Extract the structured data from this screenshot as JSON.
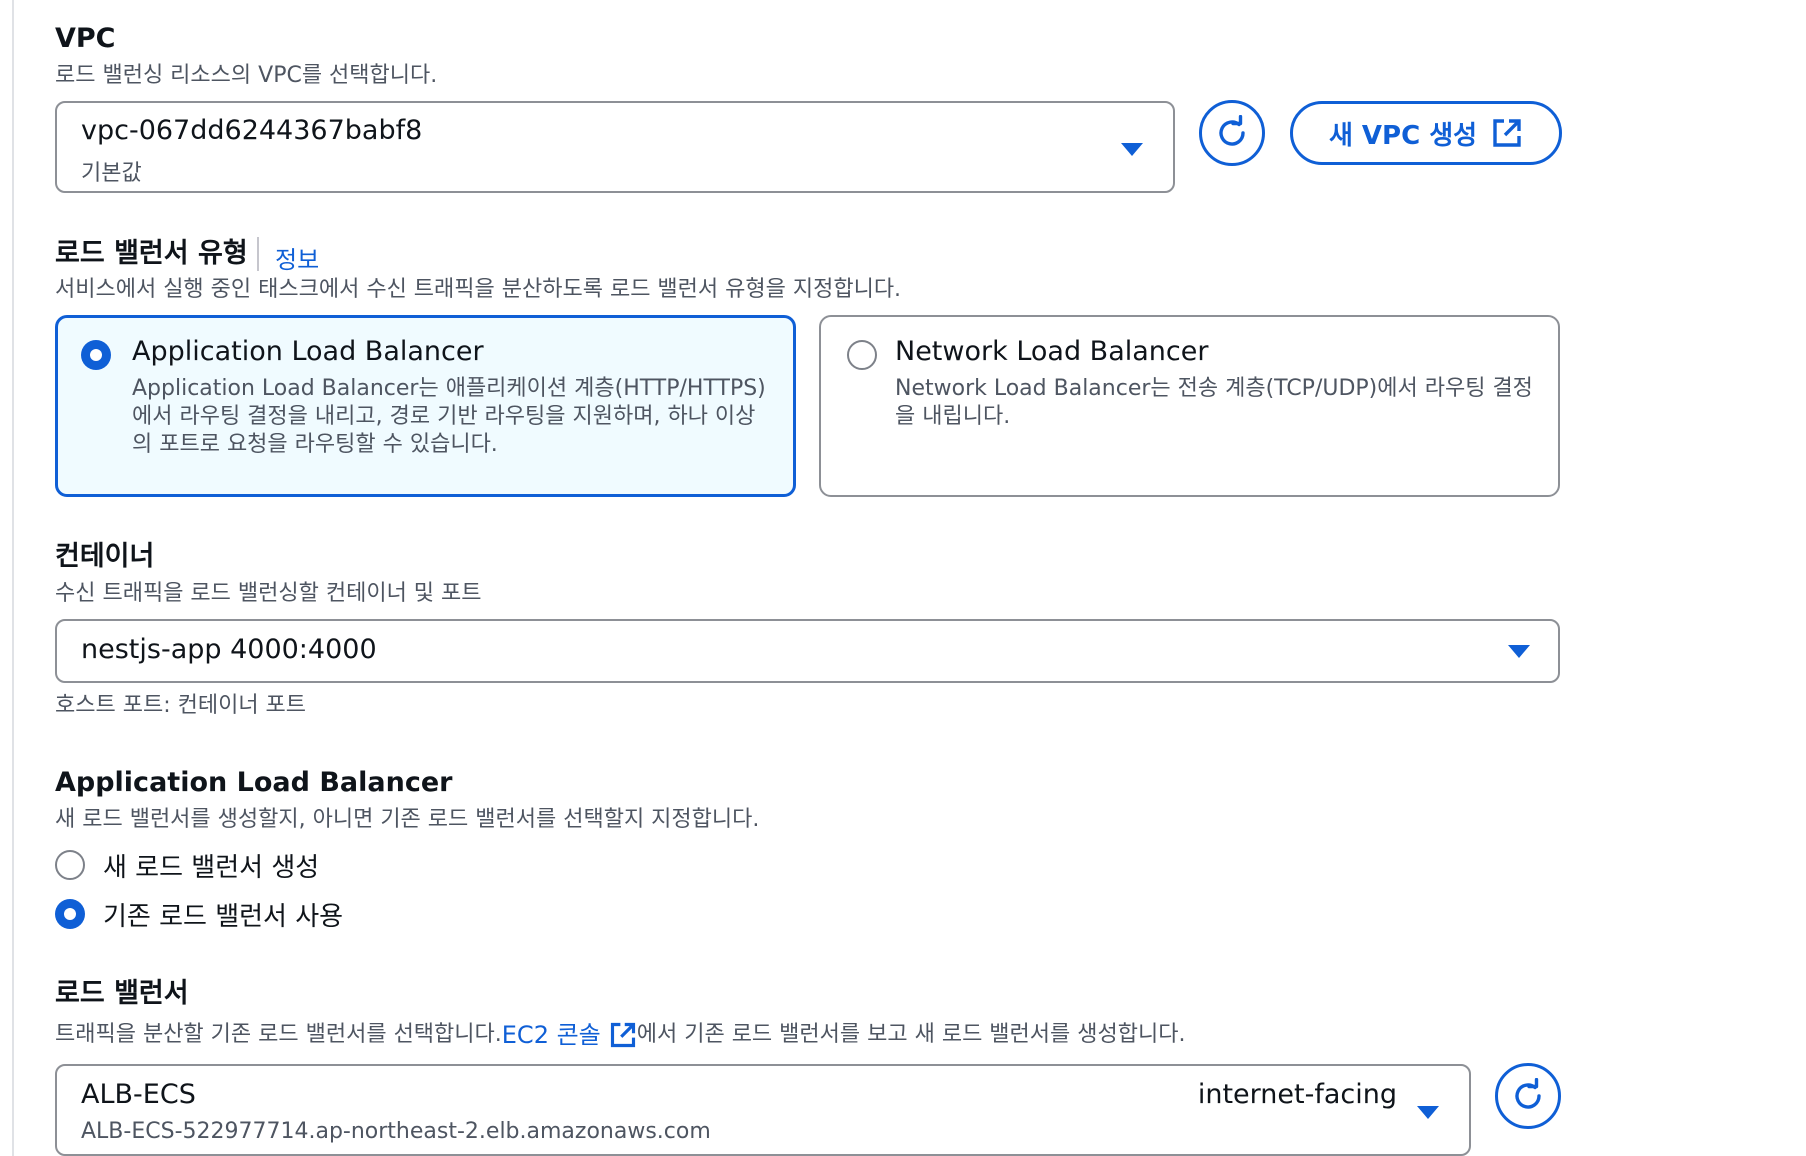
{
  "vpc": {
    "label": "VPC",
    "description": "로드 밸런싱 리소스의 VPC를 선택합니다.",
    "selected_value": "vpc-067dd6244367babf8",
    "selected_sub": "기본값",
    "create_button_label": "새 VPC 생성"
  },
  "lb_type": {
    "label": "로드 밸런서 유형",
    "info_link": "정보",
    "description": "서비스에서 실행 중인 태스크에서 수신 트래픽을 분산하도록 로드 밸런서 유형을 지정합니다.",
    "options": [
      {
        "title": "Application Load Balancer",
        "description": "Application Load Balancer는 애플리케이션 계층(HTTP/HTTPS)에서 라우팅 결정을 내리고, 경로 기반 라우팅을 지원하며, 하나 이상의 포트로 요청을 라우팅할 수 있습니다.",
        "selected": true
      },
      {
        "title": "Network Load Balancer",
        "description": "Network Load Balancer는 전송 계층(TCP/UDP)에서 라우팅 결정을 내립니다.",
        "selected": false
      }
    ]
  },
  "container": {
    "label": "컨테이너",
    "description": "수신 트래픽을 로드 밸런싱할 컨테이너 및 포트",
    "selected_value": "nestjs-app 4000:4000",
    "hint": "호스트 포트: 컨테이너 포트"
  },
  "alb": {
    "label": "Application Load Balancer",
    "description": "새 로드 밸런서를 생성할지, 아니면 기존 로드 밸런서를 선택할지 지정합니다.",
    "options": [
      {
        "label": "새 로드 밸런서 생성",
        "selected": false
      },
      {
        "label": "기존 로드 밸런서 사용",
        "selected": true
      }
    ]
  },
  "load_balancer": {
    "label": "로드 밸런서",
    "description_before": "트래픽을 분산할 기존 로드 밸런서를 선택합니다. ",
    "console_link": "EC2 콘솔",
    "description_after": "에서 기존 로드 밸런서를 보고 새 로드 밸런서를 생성합니다.",
    "selected_name": "ALB-ECS",
    "selected_dns": "ALB-ECS-522977714.ap-northeast-2.elb.amazonaws.com",
    "selected_scheme": "internet-facing"
  },
  "icons": {
    "refresh": "refresh-icon",
    "external": "external-link-icon",
    "caret": "caret-down-icon"
  },
  "colors": {
    "accent": "#0f5fd6",
    "selected_card_bg": "#f0fbff",
    "border": "#8d9096"
  }
}
